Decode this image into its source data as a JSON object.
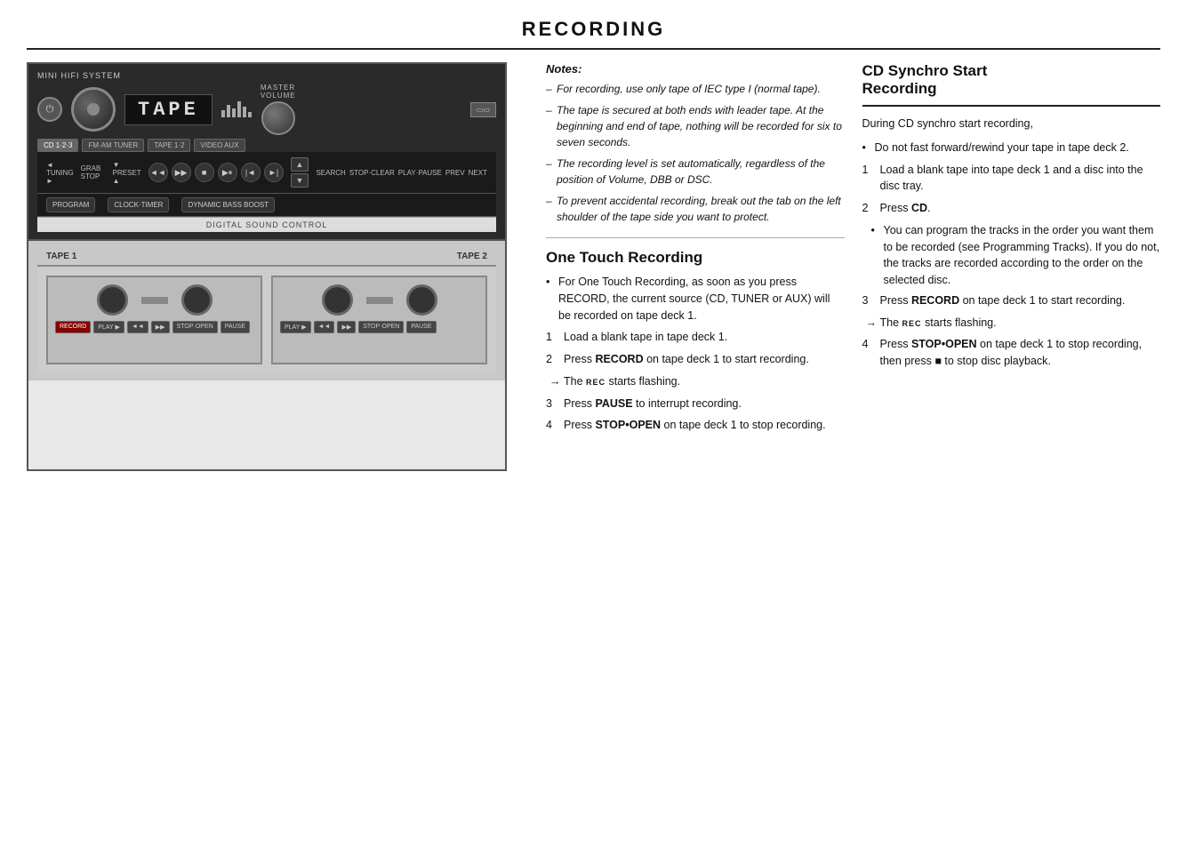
{
  "page": {
    "title": "RECORDING"
  },
  "device": {
    "brand": "MINI HIFI SYSTEM",
    "display_text": "TAPE",
    "tape1_label": "TAPE 1",
    "tape2_label": "TAPE 2",
    "digital_sound_label": "DIGITAL SOUND CONTROL",
    "source_buttons": [
      "CD",
      "TUNER",
      "TAPE 1·2",
      "VIDEO AUX",
      "MASTER VOLUME"
    ],
    "tape_buttons_deck1": [
      "RECORD",
      "PLAY ▶",
      "◄◄",
      "▶▶",
      "STOP·OPEN",
      "PAUSE"
    ],
    "tape_buttons_deck2": [
      "PLAY ▶",
      "◄◄",
      "▶▶",
      "STOP·OPEN",
      "PAUSE"
    ],
    "control_labels": [
      "PROGRAM",
      "CLOCK·TIMER",
      "DYNAMIC BASS BOOST"
    ]
  },
  "notes": {
    "title": "Notes:",
    "items": [
      "For recording, use only tape of IEC type I (normal tape).",
      "The tape is secured at both ends with leader tape. At the beginning and end of tape, nothing will be recorded for six to seven seconds.",
      "The recording level is set automatically, regardless of the position of Volume, DBB or DSC.",
      "To prevent accidental recording, break out the tab on the left shoulder of the tape side you want to protect."
    ]
  },
  "one_touch": {
    "title": "One Touch Recording",
    "bullet": "For One Touch Recording, as soon as you press RECORD, the current source (CD, TUNER or AUX) will be recorded on tape deck 1.",
    "steps": [
      {
        "num": "1",
        "text": "Load a blank tape in tape deck 1."
      },
      {
        "num": "2",
        "text_prefix": "Press ",
        "text_bold": "RECORD",
        "text_suffix": " on tape deck 1 to start recording."
      },
      {
        "num": "",
        "arrow": true,
        "text_prefix": "The ",
        "text_rec": "REC",
        "text_suffix": " starts flashing."
      },
      {
        "num": "3",
        "text_prefix": "Press ",
        "text_bold": "PAUSE",
        "text_suffix": " to interrupt recording."
      },
      {
        "num": "4",
        "text_prefix": "Press ",
        "text_bold": "STOP•OPEN",
        "text_suffix": " on tape deck 1 to stop recording."
      }
    ]
  },
  "cd_synchro": {
    "title_line1": "CD Synchro Start",
    "title_line2": "Recording",
    "intro": "During CD synchro start recording,",
    "bullet1": "Do not fast forward/rewind your tape in tape deck 2.",
    "steps": [
      {
        "num": "1",
        "text": "Load a blank tape into tape deck 1 and a disc into the disc tray."
      },
      {
        "num": "2",
        "text_prefix": "Press ",
        "text_bold": "CD",
        "text_suffix": "."
      },
      {
        "num": "",
        "bullet": true,
        "text": "You can program the tracks in the order you want them to be recorded (see Programming Tracks). If you do not, the tracks are recorded according to the order on the selected disc."
      },
      {
        "num": "3",
        "text_prefix": "Press ",
        "text_bold": "RECORD",
        "text_suffix": " on tape deck 1 to start recording."
      },
      {
        "num": "",
        "arrow": true,
        "text_prefix": "The ",
        "text_rec": "REC",
        "text_suffix": " starts flashing."
      },
      {
        "num": "4",
        "text_prefix": "Press ",
        "text_bold": "STOP•OPEN",
        "text_suffix": " on tape deck 1 to stop recording, then press ■ to stop disc playback."
      }
    ]
  }
}
